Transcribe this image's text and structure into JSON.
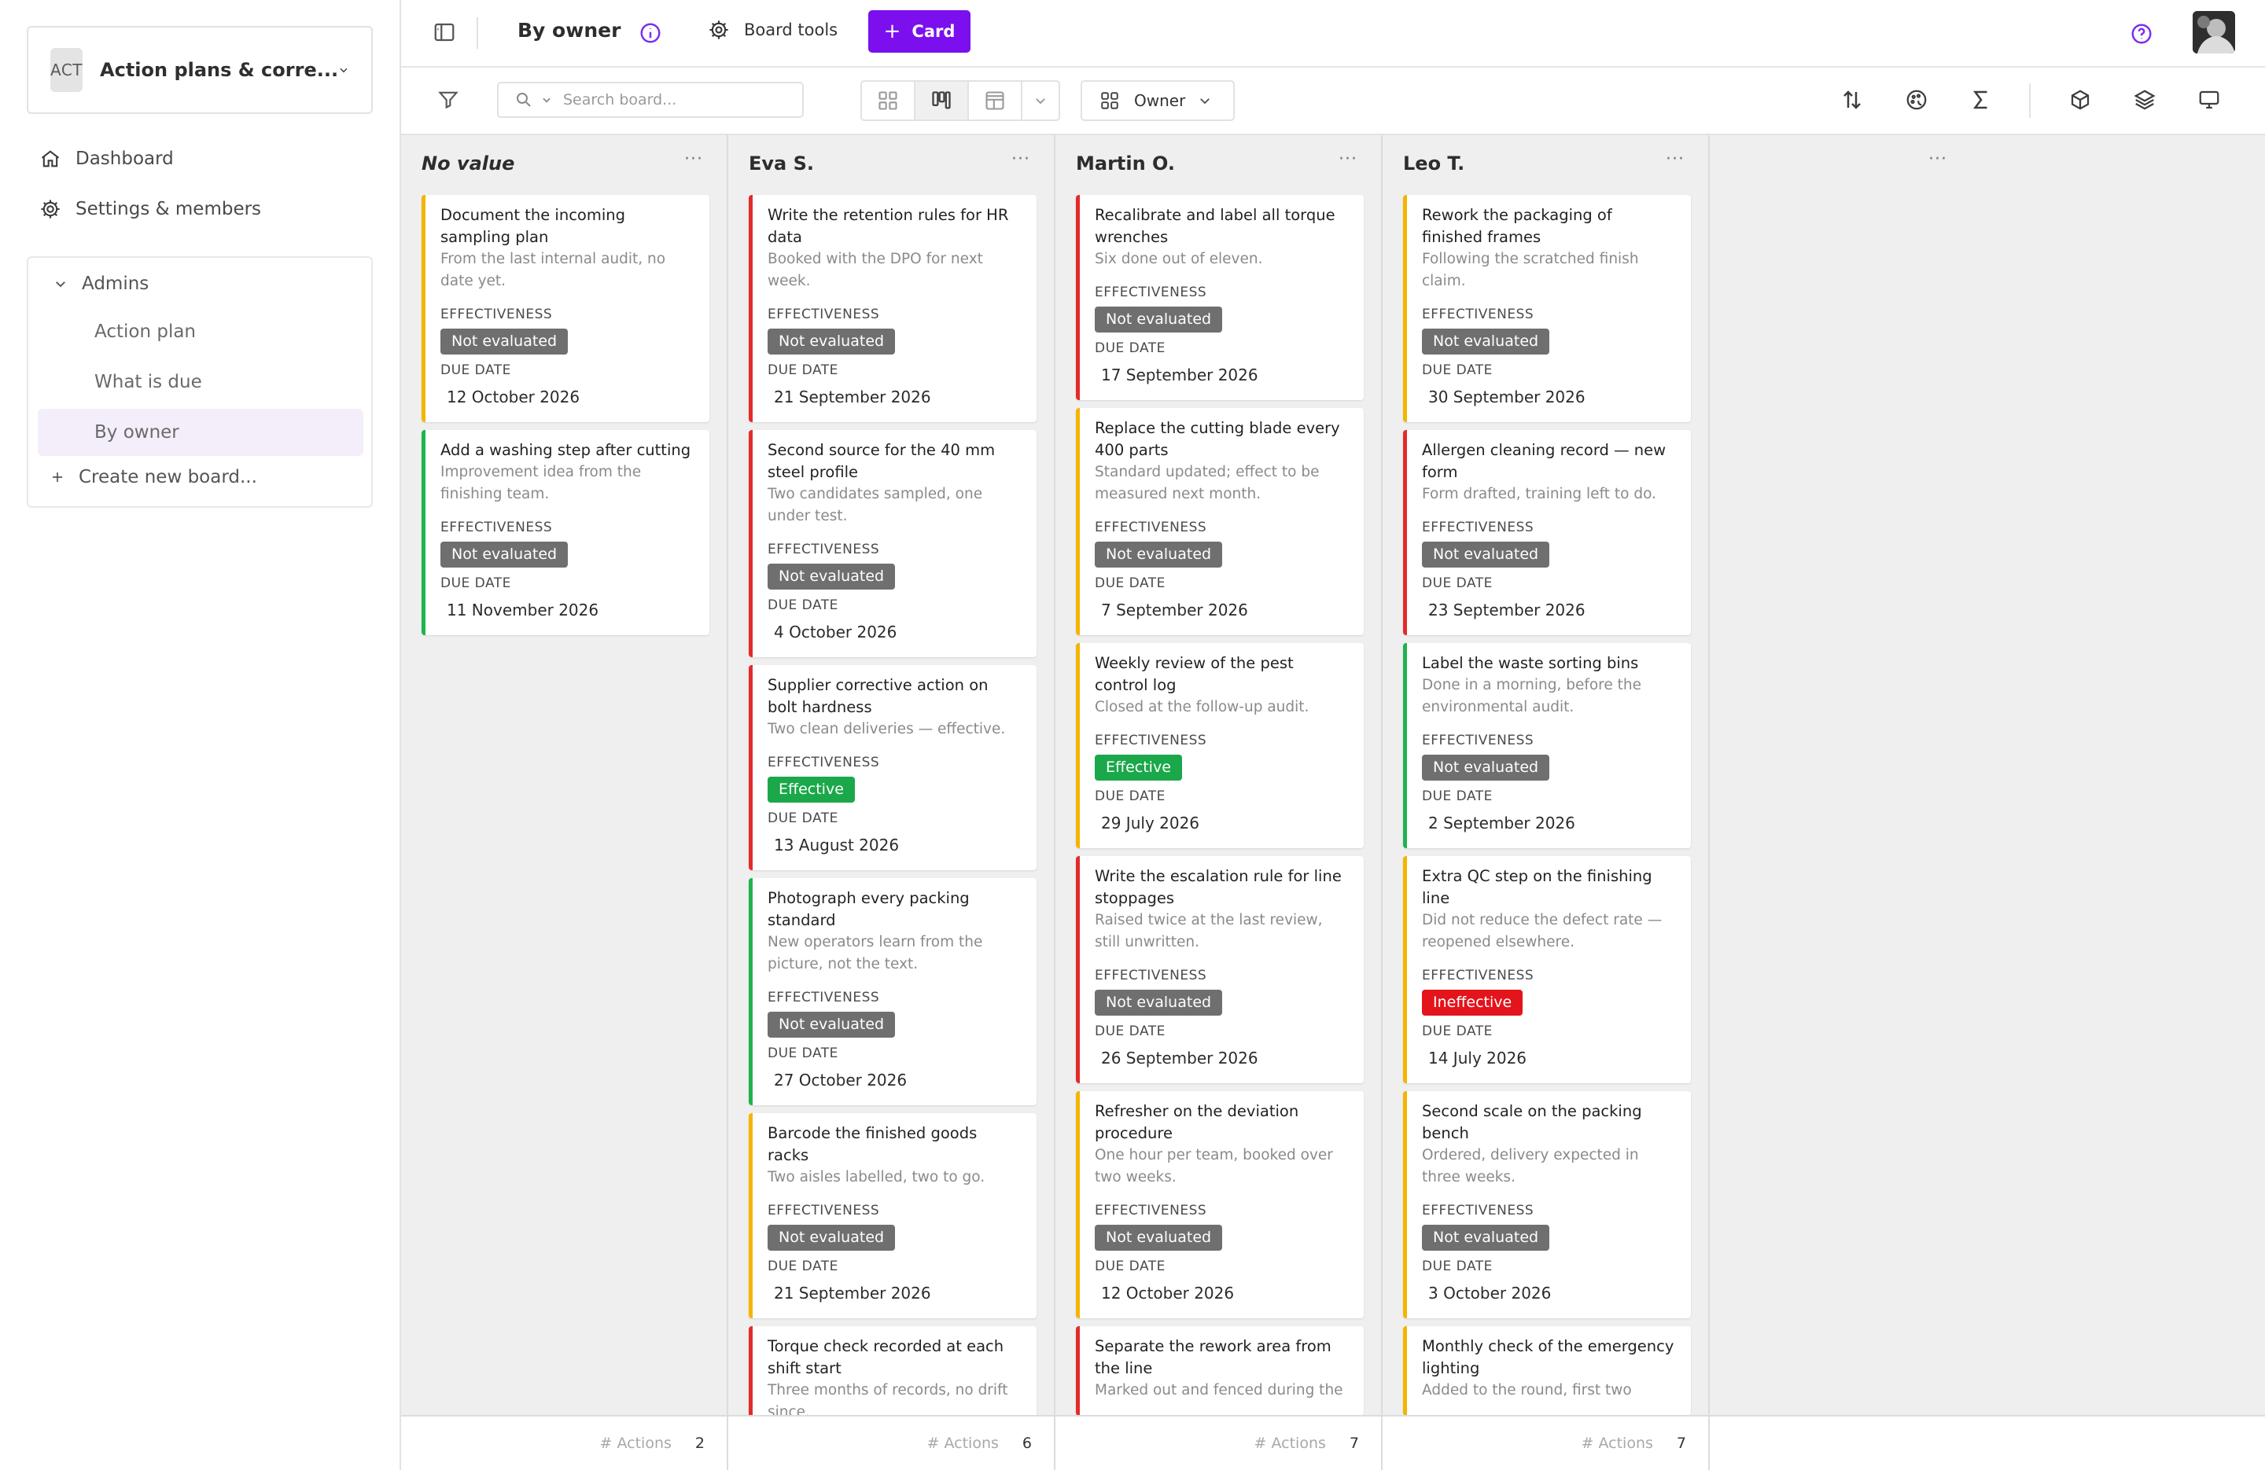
{
  "sidebar": {
    "workspace": {
      "badge": "ACT",
      "title": "Action plans & corre..."
    },
    "nav": [
      {
        "label": "Dashboard",
        "icon": "home-icon"
      },
      {
        "label": "Settings & members",
        "icon": "gear-icon"
      }
    ],
    "group": {
      "title": "Admins",
      "items": [
        "Action plan",
        "What is due",
        "By owner"
      ],
      "selected": "By owner",
      "create_label": "Create new board..."
    }
  },
  "topbar": {
    "title": "By owner",
    "board_tools_label": "Board tools",
    "card_button_label": "Card"
  },
  "toolbar": {
    "search_placeholder": "Search board...",
    "group_by_label": "Owner"
  },
  "colors": {
    "accent": "#7b0fee",
    "not_evaluated": "#6f6f6f",
    "effective": "#1aa84a",
    "ineffective": "#e3141b",
    "red": "#e32b2b",
    "yellow": "#f5b400",
    "green": "#1fb34d"
  },
  "labels": {
    "effectiveness": "EFFECTIVENESS",
    "due_date": "DUE DATE",
    "footer": "# Actions"
  },
  "columns": [
    {
      "title": "No value",
      "count": "2",
      "cards": [
        {
          "accent": "yellow",
          "title": "Document the incoming sampling plan",
          "desc": "From the last internal audit, no date yet.",
          "status": "Not evaluated",
          "due": "12 October 2026"
        },
        {
          "accent": "green",
          "title": "Add a washing step after cutting",
          "desc": "Improvement idea from the finishing team.",
          "status": "Not evaluated",
          "due": "11 November 2026"
        }
      ]
    },
    {
      "title": "Eva S.",
      "count": "6",
      "cards": [
        {
          "accent": "red",
          "title": "Write the retention rules for HR data",
          "desc": "Booked with the DPO for next week.",
          "status": "Not evaluated",
          "due": "21 September 2026"
        },
        {
          "accent": "red",
          "title": "Second source for the 40 mm steel profile",
          "desc": "Two candidates sampled, one under test.",
          "status": "Not evaluated",
          "due": "4 October 2026"
        },
        {
          "accent": "red",
          "title": "Supplier corrective action on bolt hardness",
          "desc": "Two clean deliveries — effective.",
          "status": "Effective",
          "due": "13 August 2026"
        },
        {
          "accent": "green",
          "title": "Photograph every packing standard",
          "desc": "New operators learn from the picture, not the text.",
          "status": "Not evaluated",
          "due": "27 October 2026"
        },
        {
          "accent": "yellow",
          "title": "Barcode the finished goods racks",
          "desc": "Two aisles labelled, two to go.",
          "status": "Not evaluated",
          "due": "21 September 2026"
        },
        {
          "accent": "red",
          "title": "Torque check recorded at each shift start",
          "desc": "Three months of records, no drift since.",
          "status": "",
          "due": ""
        }
      ]
    },
    {
      "title": "Martin O.",
      "count": "7",
      "cards": [
        {
          "accent": "red",
          "title": "Recalibrate and label all torque wrenches",
          "desc": "Six done out of eleven.",
          "status": "Not evaluated",
          "due": "17 September 2026"
        },
        {
          "accent": "yellow",
          "title": "Replace the cutting blade every 400 parts",
          "desc": "Standard updated; effect to be measured next month.",
          "status": "Not evaluated",
          "due": "7 September 2026"
        },
        {
          "accent": "yellow",
          "title": "Weekly review of the pest control log",
          "desc": "Closed at the follow-up audit.",
          "status": "Effective",
          "due": "29 July 2026"
        },
        {
          "accent": "red",
          "title": "Write the escalation rule for line stoppages",
          "desc": "Raised twice at the last review, still unwritten.",
          "status": "Not evaluated",
          "due": "26 September 2026"
        },
        {
          "accent": "yellow",
          "title": "Refresher on the deviation procedure",
          "desc": "One hour per team, booked over two weeks.",
          "status": "Not evaluated",
          "due": "12 October 2026"
        },
        {
          "accent": "red",
          "title": "Separate the rework area from the line",
          "desc": "Marked out and fenced during the",
          "status": "",
          "due": ""
        }
      ]
    },
    {
      "title": "Leo T.",
      "count": "7",
      "cards": [
        {
          "accent": "yellow",
          "title": "Rework the packaging of finished frames",
          "desc": "Following the scratched finish claim.",
          "status": "Not evaluated",
          "due": "30 September 2026"
        },
        {
          "accent": "red",
          "title": "Allergen cleaning record — new form",
          "desc": "Form drafted, training left to do.",
          "status": "Not evaluated",
          "due": "23 September 2026"
        },
        {
          "accent": "green",
          "title": "Label the waste sorting bins",
          "desc": "Done in a morning, before the environmental audit.",
          "status": "Not evaluated",
          "due": "2 September 2026"
        },
        {
          "accent": "yellow",
          "title": "Extra QC step on the finishing line",
          "desc": "Did not reduce the defect rate — reopened elsewhere.",
          "status": "Ineffective",
          "due": "14 July 2026"
        },
        {
          "accent": "yellow",
          "title": "Second scale on the packing bench",
          "desc": "Ordered, delivery expected in three weeks.",
          "status": "Not evaluated",
          "due": "3 October 2026"
        },
        {
          "accent": "yellow",
          "title": "Monthly check of the emergency lighting",
          "desc": "Added to the round, first two",
          "status": "",
          "due": ""
        }
      ]
    }
  ]
}
